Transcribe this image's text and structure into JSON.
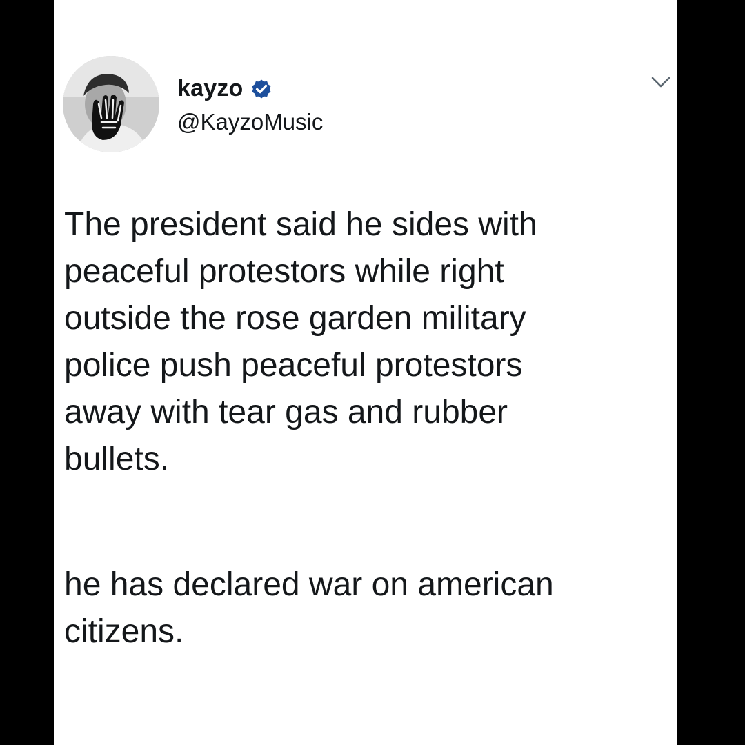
{
  "tweet": {
    "author": {
      "display_name": "kayzo",
      "handle": "@KayzoMusic",
      "verified": true,
      "avatar_icon": "profile-photo"
    },
    "menu_icon": "chevron-down-icon",
    "paragraphs": [
      "The president said he sides with\npeaceful protestors while right\noutside the rose garden military\npolice push peaceful protestors\naway with tear gas and rubber\nbullets.",
      "he has declared war on american\ncitizens."
    ]
  },
  "colors": {
    "border": "#000000",
    "card_bg": "#ffffff",
    "text": "#14171a",
    "verified_badge": "#1d4f9c"
  }
}
